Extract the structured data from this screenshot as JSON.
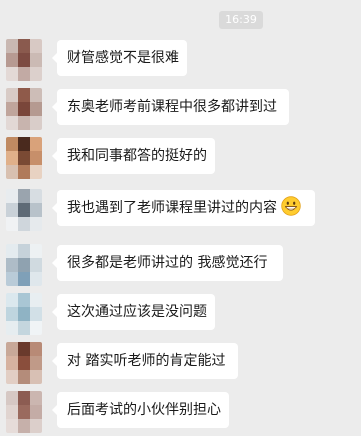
{
  "timestamp": "16:39",
  "messages": [
    {
      "text": "财管感觉不是很难",
      "avatar": [
        "#c9b8b2",
        "#8a5a4e",
        "#d8c9c4",
        "#b79a92",
        "#7d4b42",
        "#cbbab4",
        "#e3d9d6",
        "#c2aaa4",
        "#dcd0cc"
      ]
    },
    {
      "text": "东奥老师考前课程中很多都讲到过",
      "avatar": [
        "#d8cbc6",
        "#8f5a4a",
        "#cdbdb7",
        "#c0a59c",
        "#7a463a",
        "#b59a91",
        "#e2d8d5",
        "#c8b4ae",
        "#d9cdc9"
      ]
    },
    {
      "text": "我和同事都答的挺好的",
      "avatar": [
        "#c08a62",
        "#4a2a1e",
        "#d9a27a",
        "#e0b08a",
        "#7a4a34",
        "#c78f6a",
        "#d8c0b0",
        "#b07a5a",
        "#e8d2c2"
      ]
    },
    {
      "text": "我也遇到了老师课程里讲过的内容",
      "emoji": "grinning-face-icon",
      "avatar": [
        "#e8ecef",
        "#9aa4ae",
        "#d7dde2",
        "#c9d1d8",
        "#5e6a76",
        "#b8c2ca",
        "#f0f2f4",
        "#cfd6dc",
        "#e6eaed"
      ]
    },
    {
      "text": "很多都是老师讲过的   我感觉还行",
      "avatar": [
        "#e4ebef",
        "#c6d2da",
        "#edf1f3",
        "#aebcc7",
        "#8fa2b0",
        "#d0dae0",
        "#b9cbd8",
        "#7fa0b8",
        "#dfe7ec"
      ]
    },
    {
      "text": "这次通过应该是没问题",
      "avatar": [
        "#dbe8ee",
        "#a9c6d4",
        "#e8eef1",
        "#bfd5df",
        "#8fb3c4",
        "#d2e0e7",
        "#e6edf0",
        "#c4d6de",
        "#f0f4f6"
      ]
    },
    {
      "text": "对  踏实听老师的肯定能过",
      "avatar": [
        "#c8a898",
        "#6a3a2c",
        "#b88a76",
        "#d6b2a0",
        "#8a4e3c",
        "#c09a88",
        "#e2cec4",
        "#b48c7a",
        "#d8c0b4"
      ]
    },
    {
      "text": "后面考试的小伙伴别担心",
      "avatar": [
        "#d6c8c4",
        "#8c5c52",
        "#cbb6b0",
        "#e0d4d0",
        "#9a6a5e",
        "#c4aca6",
        "#e6dcd9",
        "#c6b0aa",
        "#dccfcb"
      ]
    }
  ]
}
